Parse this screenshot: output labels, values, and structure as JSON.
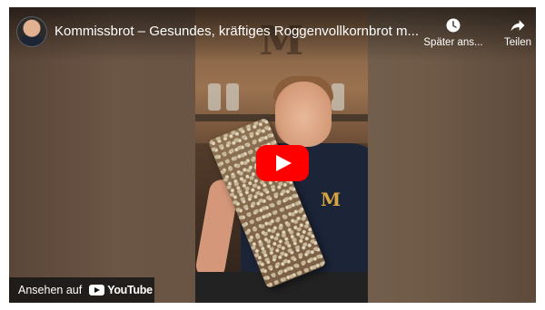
{
  "video": {
    "title": "Kommissbrot – Gesundes, kräftiges Roggenvollkornbrot m...",
    "channel_avatar_icon": "channel-avatar-icon"
  },
  "actions": {
    "watch_later": {
      "label": "Später ans...",
      "icon": "clock-icon"
    },
    "share": {
      "label": "Teilen",
      "icon": "share-arrow-icon"
    }
  },
  "play_button": {
    "icon": "play-icon",
    "color": "#ff0000"
  },
  "watch_on": {
    "label": "Ansehen auf",
    "brand": "YouTube"
  }
}
